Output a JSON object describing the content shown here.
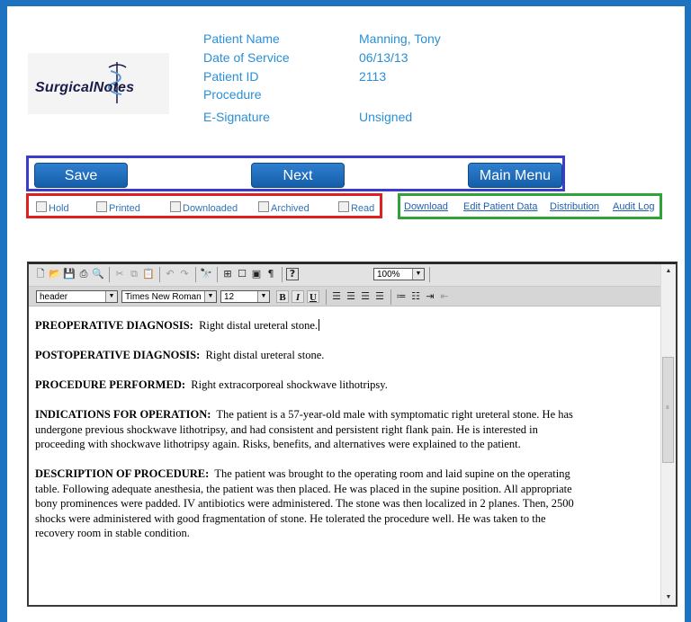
{
  "logo": {
    "text": "SurgicalNotes"
  },
  "patient_info": {
    "labels": [
      "Patient Name",
      "Date of Service",
      "Patient ID",
      "Procedure",
      "E-Signature"
    ],
    "values": {
      "name": "Manning, Tony",
      "date": "06/13/13",
      "id": "2113",
      "procedure": "",
      "signature": "Unsigned"
    }
  },
  "buttons": {
    "save": "Save",
    "next": "Next",
    "main_menu": "Main Menu"
  },
  "checkboxes": [
    "Hold",
    "Printed",
    "Downloaded",
    "Archived",
    "Read"
  ],
  "links": [
    "Download",
    "Edit Patient Data",
    "Distribution",
    "Audit Log"
  ],
  "colors": {
    "frame": "#1e73c0",
    "accent_text": "#2a8fd6",
    "button": "#1a68b8",
    "box_buttons": "#3b3ccc",
    "box_checkboxes": "#e02020",
    "box_links": "#2fa33a"
  },
  "editor": {
    "toolbar_icons": [
      "new-icon",
      "open-icon",
      "save-icon",
      "print-icon",
      "print-preview-icon",
      "cut-icon",
      "copy-icon",
      "paste-icon",
      "undo-icon",
      "redo-icon",
      "find-icon",
      "insert-icon",
      "frame-icon",
      "frame2-icon",
      "paragraph-icon",
      "help-icon"
    ],
    "zoom": "100%",
    "style": "header",
    "font": "Times New Roman",
    "size": "12",
    "format_buttons": {
      "bold": "B",
      "italic": "I",
      "underline": "U"
    },
    "document": [
      {
        "heading": "PREOPERATIVE DIAGNOSIS:",
        "text": "Right distal ureteral stone."
      },
      {
        "heading": "POSTOPERATIVE DIAGNOSIS:",
        "text": "Right distal ureteral stone."
      },
      {
        "heading": "PROCEDURE PERFORMED:",
        "text": "Right extracorporeal shockwave lithotripsy."
      },
      {
        "heading": "INDICATIONS FOR OPERATION:",
        "text": "The patient is a 57-year-old male with symptomatic right ureteral stone.  He has undergone previous shockwave lithotripsy, and had consistent and persistent right flank pain.  He is interested in proceeding with shockwave lithotripsy again.  Risks, benefits, and alternatives were explained to the patient."
      },
      {
        "heading": "DESCRIPTION OF PROCEDURE:",
        "text": "The patient was brought to the operating room and laid supine on the operating table.  Following adequate anesthesia, the patient was then placed.  He was placed in the supine position.  All appropriate bony prominences were padded.  IV antibiotics were administered.  The stone was then localized in 2 planes.  Then, 2500 shocks were administered with good fragmentation of stone.  He tolerated the procedure well.  He was taken to the recovery room in stable condition."
      }
    ]
  }
}
